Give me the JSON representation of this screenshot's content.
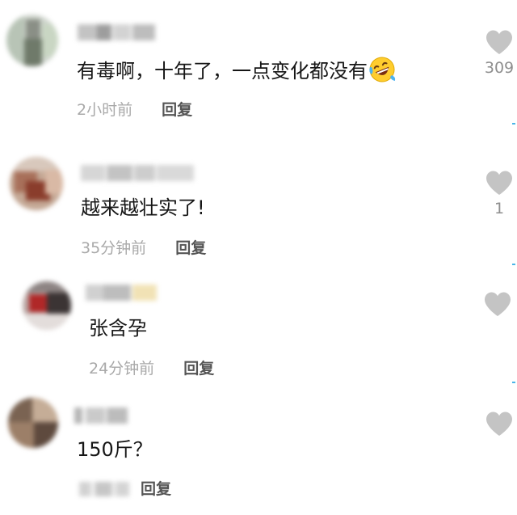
{
  "comments": [
    {
      "text": "有毒啊，十年了，一点变化都没有",
      "emoji": "rolling-on-floor-laughing-emoji",
      "timestamp": "2小时前",
      "reply_label": "回复",
      "like_count": "309"
    },
    {
      "text": "越来越壮实了!",
      "timestamp": "35分钟前",
      "reply_label": "回复",
      "like_count": "1"
    },
    {
      "text": "张含孕",
      "timestamp": "24分钟前",
      "reply_label": "回复",
      "like_count": ""
    },
    {
      "text": "150斤？",
      "timestamp": "",
      "reply_label": "回复",
      "like_count": ""
    }
  ],
  "icons": {
    "like": "heart-icon",
    "emoji": "rolling-on-floor-laughing-emoji"
  },
  "colors": {
    "text": "#161616",
    "meta": "#a9a9a9",
    "reply": "#555555",
    "heart": "#c4c4c4",
    "edge_accent": "#4ab5e8"
  }
}
